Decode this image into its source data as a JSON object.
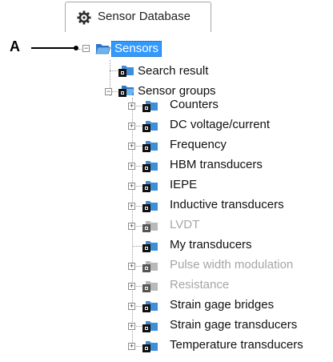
{
  "tab": {
    "label": "Sensor Database",
    "icon": "gear-icon"
  },
  "callout": {
    "letter": "A"
  },
  "tree": {
    "root": {
      "label": "Sensors",
      "icon": "open-folder-icon",
      "expander": "−"
    },
    "search_result": {
      "label": "Search result",
      "icon": "locked-folder-icon"
    },
    "sensor_groups": {
      "label": "Sensor groups",
      "icon": "locked-open-folder-icon",
      "expander": "−"
    },
    "groups": [
      {
        "label": "Counters",
        "expander": "+",
        "disabled": false
      },
      {
        "label": "DC voltage/current",
        "expander": "+",
        "disabled": false
      },
      {
        "label": "Frequency",
        "expander": "+",
        "disabled": false
      },
      {
        "label": "HBM transducers",
        "expander": "+",
        "disabled": false
      },
      {
        "label": "IEPE",
        "expander": "+",
        "disabled": false
      },
      {
        "label": "Inductive transducers",
        "expander": "+",
        "disabled": false
      },
      {
        "label": "LVDT",
        "expander": "+",
        "disabled": true
      },
      {
        "label": "My transducers",
        "expander": "",
        "disabled": false
      },
      {
        "label": "Pulse width modulation",
        "expander": "+",
        "disabled": true
      },
      {
        "label": "Resistance",
        "expander": "+",
        "disabled": true
      },
      {
        "label": "Strain gage bridges",
        "expander": "+",
        "disabled": false
      },
      {
        "label": "Strain gage transducers",
        "expander": "+",
        "disabled": false
      },
      {
        "label": "Temperature transducers",
        "expander": "+",
        "disabled": false
      }
    ]
  },
  "colors": {
    "selection": "#3399ff",
    "folder": "#3f8fd8",
    "disabled_text": "#a6a6a6"
  }
}
